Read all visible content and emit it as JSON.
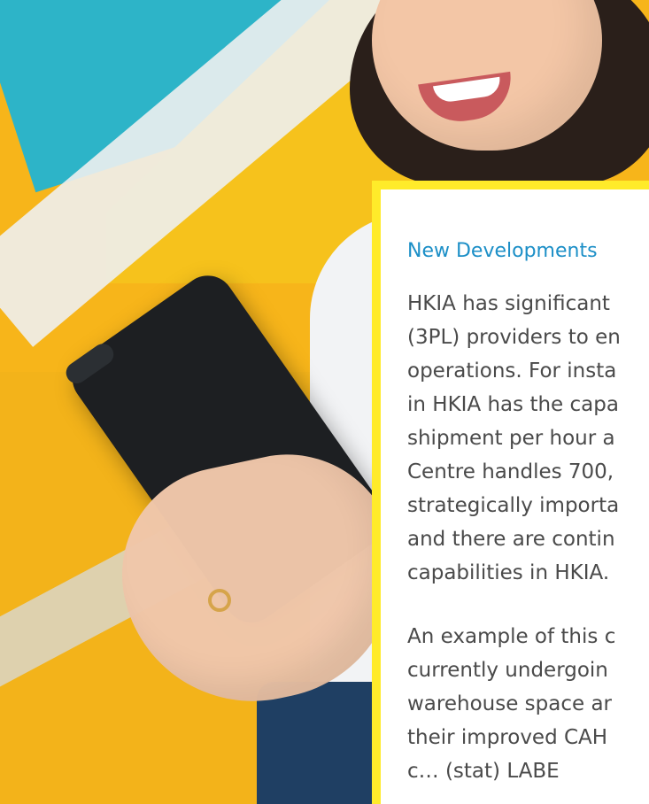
{
  "panel": {
    "heading": "New Developments",
    "paragraphs": [
      {
        "lines": [
          "HKIA has significant",
          "(3PL) providers to en",
          "operations. For insta",
          "in HKIA has the capa",
          "shipment per hour a",
          "Centre handles 700,",
          "strategically importa",
          "and there are contin",
          "capabilities in HKIA."
        ]
      },
      {
        "lines": [
          "An example of this c",
          "currently undergoin",
          "warehouse space ar",
          "their improved CAH",
          "c… (stat) LABE"
        ]
      }
    ]
  },
  "colors": {
    "panel_border": "#ffeb2a",
    "heading": "#1c8fc7",
    "body_text": "#4a4a4a"
  }
}
